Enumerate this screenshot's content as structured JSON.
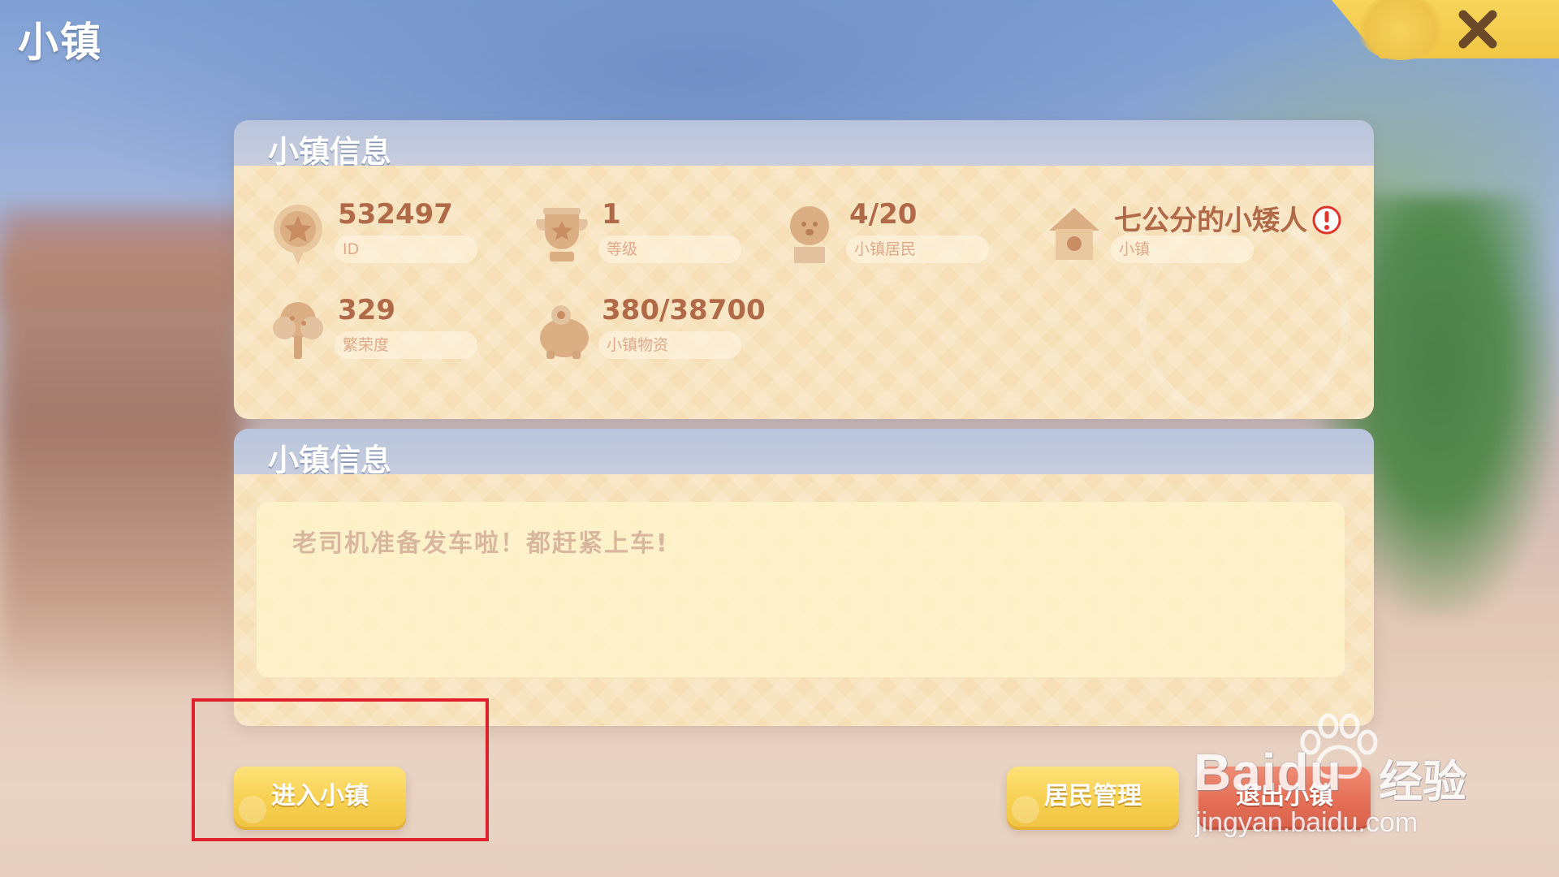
{
  "screen": {
    "title": "小镇"
  },
  "info_panel": {
    "title": "小镇信息",
    "stats": [
      {
        "value": "532497",
        "label": "ID",
        "icon": "star-badge-icon"
      },
      {
        "value": "1",
        "label": "等级",
        "icon": "trophy-icon"
      },
      {
        "value": "4/20",
        "label": "小镇居民",
        "icon": "resident-icon"
      },
      {
        "value": "七公分的小矮人",
        "label": "小镇",
        "icon": "house-icon"
      },
      {
        "value": "329",
        "label": "繁荣度",
        "icon": "tree-icon"
      },
      {
        "value": "380/38700",
        "label": "小镇物资",
        "icon": "supply-bag-icon"
      }
    ]
  },
  "motto_panel": {
    "title": "小镇信息",
    "text": "老司机准备发车啦！都赶紧上车!"
  },
  "buttons": {
    "enter": "进入小镇",
    "resident": "居民管理",
    "leave": "退出小镇"
  },
  "watermark": {
    "brand": "Baidu",
    "suffix": "经验",
    "url": "jingyan.baidu.com"
  },
  "colors": {
    "panel_header": "#b9c4dc",
    "panel_body": "#f6dfb6",
    "stat_value": "#b06a48",
    "button_yellow": "#f6cf4e",
    "button_red": "#e36e55",
    "highlight": "#e0202a"
  }
}
